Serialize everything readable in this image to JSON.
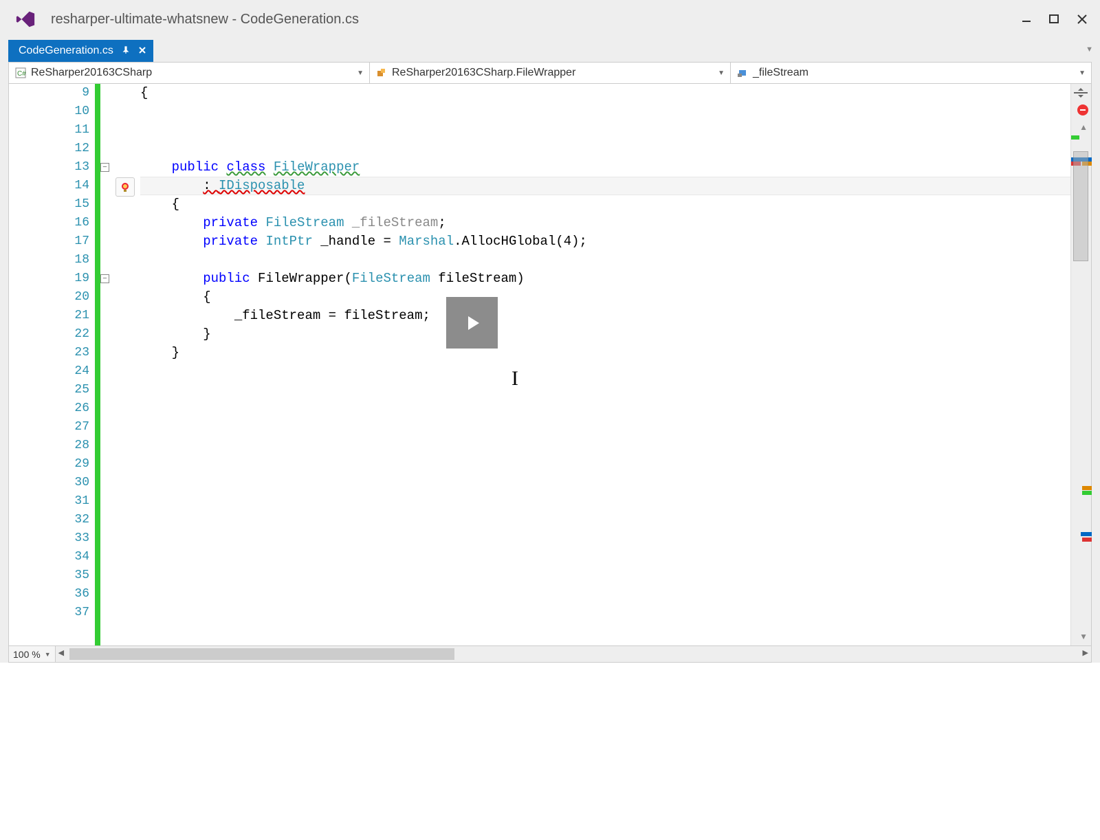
{
  "window": {
    "title": "resharper-ultimate-whatsnew - CodeGeneration.cs"
  },
  "tab": {
    "name": "CodeGeneration.cs"
  },
  "nav": {
    "namespace": "ReSharper20163CSharp",
    "class": "ReSharper20163CSharp.FileWrapper",
    "member": "_fileStream"
  },
  "zoom": "100 %",
  "line_start": 9,
  "line_end": 37,
  "code": {
    "l9": "{",
    "l13_public": "public",
    "l13_class": "class",
    "l13_name": "FileWrapper",
    "l14_colon": ": ",
    "l14_iface": "IDisposable",
    "l15": "{",
    "l16_priv": "private",
    "l16_type": "FileStream",
    "l16_field": "_fileStream",
    "l16_semi": ";",
    "l17_priv": "private",
    "l17_type": "IntPtr",
    "l17_field": " _handle = ",
    "l17_marshal": "Marshal",
    "l17_rest": ".AllocHGlobal(4);",
    "l19_pub": "public",
    "l19_ctor": " FileWrapper(",
    "l19_ptype": "FileStream",
    "l19_pname": " fileStream)",
    "l20": "{",
    "l21": "_fileStream = fileStream;",
    "l22": "}",
    "l23": "}"
  }
}
